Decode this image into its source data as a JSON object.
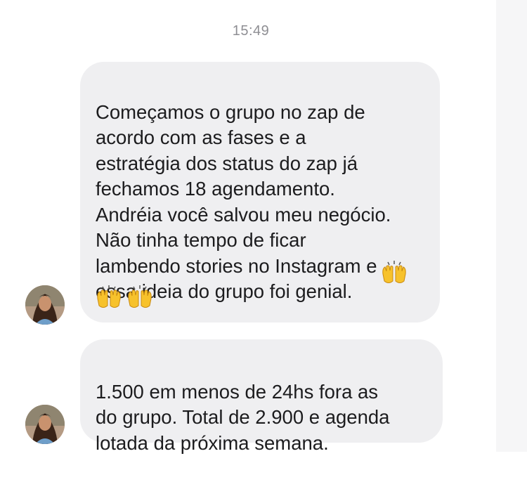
{
  "chat": {
    "timestamp": "15:49",
    "messages": [
      {
        "text": "Começamos o grupo no zap de\nacordo com as fases e a\nestratégia dos status do zap já\nfechamos 18 agendamento.\nAndréia você salvou meu negócio.\nNão tinha tempo de ficar\nlambendo stories no Instagram e\nessa ideia do grupo foi genial.",
        "emoji": "raising-hands",
        "emoji_count": 3
      },
      {
        "text": "1.500 em menos de 24hs fora as\ndo grupo. Total de 2.900 e agenda\nlotada da próxima semana."
      }
    ]
  },
  "colors": {
    "bubble": "#efeff1",
    "text": "#1c1c1e",
    "timestamp": "#8e8e93",
    "emoji": "#f7c22c"
  },
  "icons": {
    "emoji": "raising-hands-emoji",
    "avatar": "user-avatar-photo"
  }
}
